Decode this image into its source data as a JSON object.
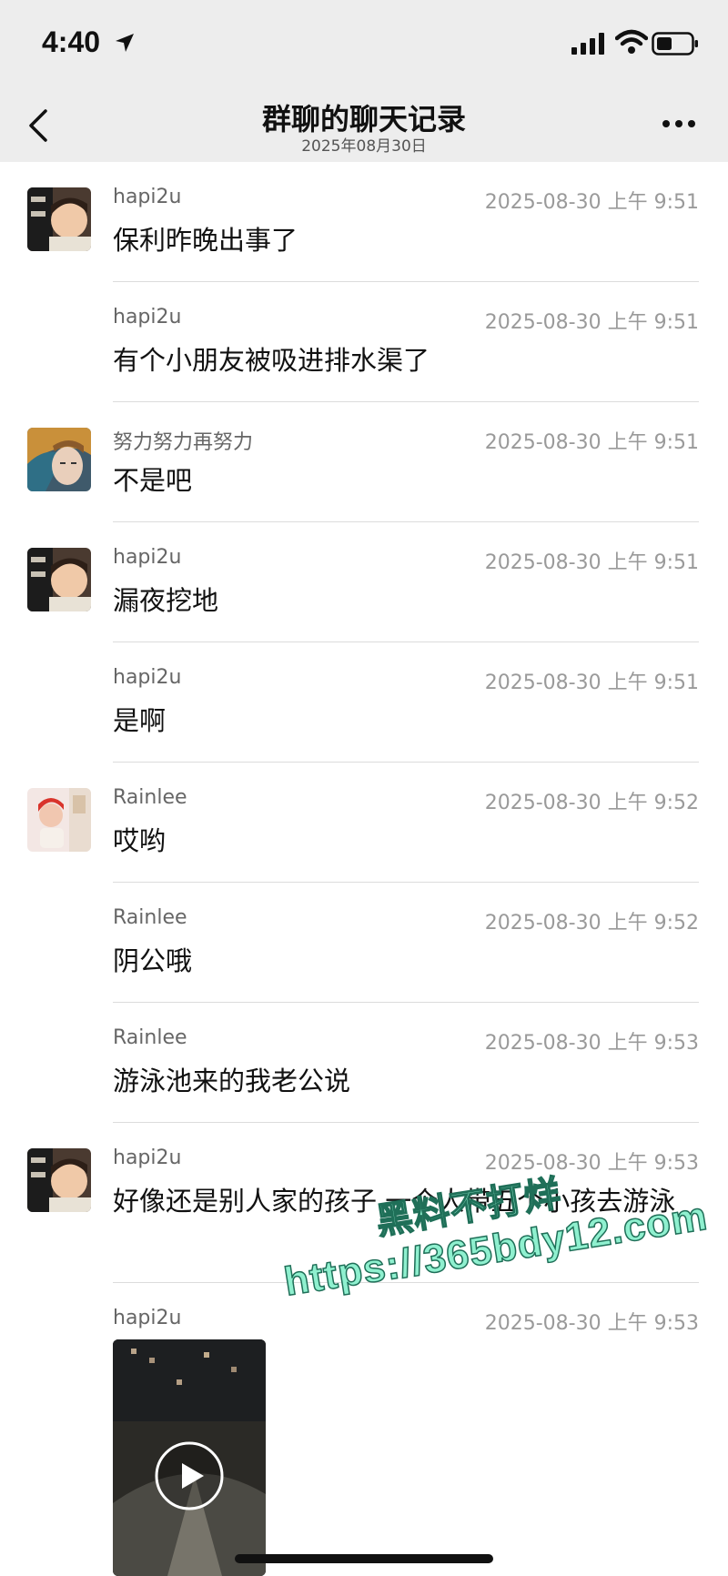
{
  "status_bar": {
    "time": "4:40"
  },
  "nav": {
    "title": "群聊的聊天记录",
    "subtitle": "2025年08月30日"
  },
  "messages": [
    {
      "sender": "hapi2u",
      "time": "2025-08-30 上午 9:51",
      "text": "保利昨晚出事了",
      "avatar": "baby"
    },
    {
      "sender": "hapi2u",
      "time": "2025-08-30 上午 9:51",
      "text": "有个小朋友被吸进排水渠了",
      "avatar": ""
    },
    {
      "sender": "努力努力再努力",
      "time": "2025-08-30 上午 9:51",
      "text": "不是吧",
      "avatar": "woman"
    },
    {
      "sender": "hapi2u",
      "time": "2025-08-30 上午 9:51",
      "text": "漏夜挖地",
      "avatar": "baby"
    },
    {
      "sender": "hapi2u",
      "time": "2025-08-30 上午 9:51",
      "text": "是啊",
      "avatar": ""
    },
    {
      "sender": "Rainlee",
      "time": "2025-08-30 上午 9:52",
      "text": "哎哟",
      "avatar": "child"
    },
    {
      "sender": "Rainlee",
      "time": "2025-08-30 上午 9:52",
      "text": "阴公哦",
      "avatar": ""
    },
    {
      "sender": "Rainlee",
      "time": "2025-08-30 上午 9:53",
      "text": "游泳池来的我老公说",
      "avatar": ""
    },
    {
      "sender": "hapi2u",
      "time": "2025-08-30 上午 9:53",
      "text": "好像还是别人家的孩子 一个人带五个小孩去游泳",
      "avatar": "baby"
    },
    {
      "sender": "hapi2u",
      "time": "2025-08-30 上午 9:53",
      "text": "",
      "avatar": ""
    }
  ],
  "watermark": {
    "line1": "黑料不打烊",
    "line2": "https://365bdy12.com"
  },
  "colors": {
    "bar_bg": "#ededed",
    "watermark": "#8ff0cf"
  }
}
